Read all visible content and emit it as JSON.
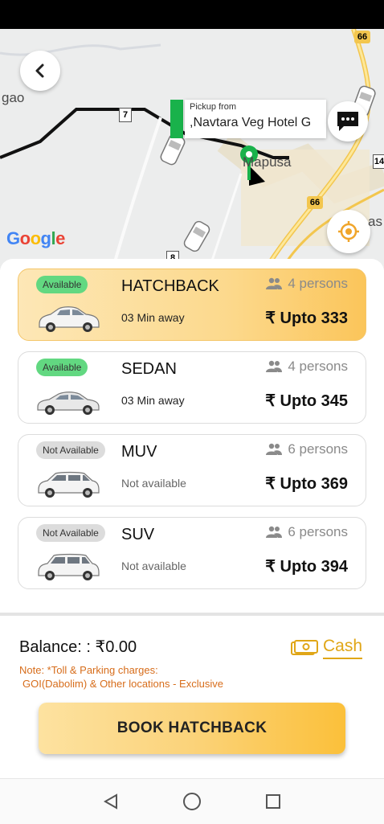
{
  "map": {
    "pickup_title": "Pickup from",
    "pickup_value": ",Navtara Veg Hotel G",
    "place_left": "gao",
    "place_center": "Mapusa",
    "place_right": "as",
    "road_66_top": "66",
    "road_66_mid": "66",
    "road_7": "7",
    "road_8": "8",
    "road_14": "14",
    "google": "Google",
    "icons": {
      "back": "back-arrow-icon",
      "chat": "chat-icon",
      "locate": "my-location-icon"
    }
  },
  "cars": [
    {
      "status": "Available",
      "name": "HATCHBACK",
      "persons": "4 persons",
      "eta": "03 Min away",
      "price": "₹ Upto 333",
      "available": true,
      "selected": true
    },
    {
      "status": "Available",
      "name": "SEDAN",
      "persons": "4 persons",
      "eta": "03 Min away",
      "price": "₹ Upto 345",
      "available": true,
      "selected": false
    },
    {
      "status": "Not Available",
      "name": "MUV",
      "persons": "6 persons",
      "eta": "Not available",
      "price": "₹ Upto 369",
      "available": false,
      "selected": false
    },
    {
      "status": "Not Available",
      "name": "SUV",
      "persons": "6 persons",
      "eta": "Not available",
      "price": "₹ Upto 394",
      "available": false,
      "selected": false
    }
  ],
  "footer": {
    "balance": "Balance: : ₹0.00",
    "cash": "Cash",
    "note_line1": "Note: *Toll & Parking charges:",
    "note_line2": "GOI(Dabolim) & Other locations - Exclusive",
    "book_button": "BOOK HATCHBACK"
  },
  "colors": {
    "accent": "#fbc55a",
    "available": "#62d881",
    "note": "#d76d1b",
    "cash": "#e0a617",
    "pin": "#19b24b"
  }
}
